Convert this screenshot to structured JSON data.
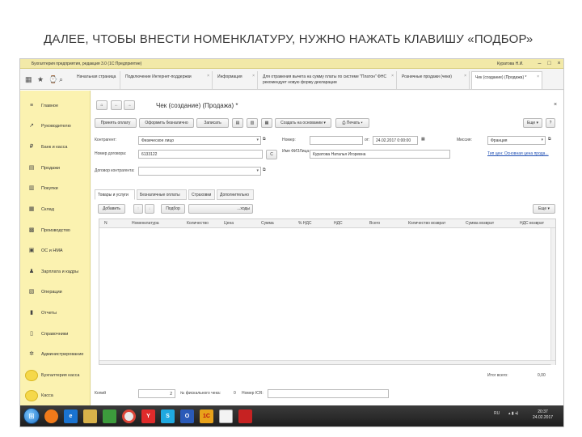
{
  "slide": {
    "title": "ДАЛЕЕ, ЧТОБЫ ВНЕСТИ НОМЕНКЛАТУРУ, НУЖНО НАЖАТЬ КЛАВИШУ «ПОДБОР»"
  },
  "window": {
    "title": "Бухгалтерия предприятия, редакция 3.0  (1С:Предприятие)",
    "user": "Куратова Н.И."
  },
  "tabs": [
    {
      "label": "Начальная страница"
    },
    {
      "label": "Подключение Интернет-поддержки"
    },
    {
      "label": "Информация"
    },
    {
      "label": "Для отражения вычета на сумму платы по системе \"Платон\" ФНС рекомендует новую форму декларации"
    },
    {
      "label": "Розничные продажи (чеки)"
    },
    {
      "label": "Чек (создание) (Продажа) *"
    }
  ],
  "sidebar": {
    "items": [
      {
        "label": "Главное",
        "icon": "menu-icon"
      },
      {
        "label": "Руководителю",
        "icon": "chart-icon"
      },
      {
        "label": "Банк и касса",
        "icon": "ruble-icon"
      },
      {
        "label": "Продажи",
        "icon": "sales-icon"
      },
      {
        "label": "Покупки",
        "icon": "cart-icon"
      },
      {
        "label": "Склад",
        "icon": "warehouse-icon"
      },
      {
        "label": "Производство",
        "icon": "factory-icon"
      },
      {
        "label": "ОС и НМА",
        "icon": "assets-icon"
      },
      {
        "label": "Зарплата и кадры",
        "icon": "people-icon"
      },
      {
        "label": "Операции",
        "icon": "operations-icon"
      },
      {
        "label": "Отчеты",
        "icon": "reports-icon"
      },
      {
        "label": "Справочники",
        "icon": "book-icon"
      },
      {
        "label": "Администрирование",
        "icon": "gear-icon"
      },
      {
        "label": "Бухгалтерия касса",
        "icon": "coins-icon"
      },
      {
        "label": "Касса",
        "icon": "coins-icon"
      }
    ]
  },
  "doc": {
    "title": "Чек (создание) (Продажа) *",
    "toolbar": {
      "accept_payment": "Принять оплату",
      "cashless": "Оформить безналично",
      "save": "Записать",
      "create_based": "Создать на основании",
      "print": "Печать",
      "more": "Еще",
      "help": "?"
    },
    "form": {
      "contractor_label": "Контрагент:",
      "contractor_value": "Физическое лицо",
      "number_label": "Номер:",
      "number_value": "",
      "from_label": "от:",
      "date_value": "24.02.2017  0:00:00",
      "mission_label": "Миссия:",
      "mission_value": "Франция",
      "contract_no_label": "Номер договора:",
      "contract_no_value": "6133122",
      "fiz_label": "Имя ФИЗЛица:",
      "fiz_value": "Куратова Наталья Игоревна",
      "price_type_link": "Тип цен: Основная цена прода...",
      "contract_label": "Договор контрагента:",
      "contract_value": ""
    },
    "subtabs": [
      {
        "label": "Товары и услуги"
      },
      {
        "label": "Безналичные оплаты"
      },
      {
        "label": "Страховки"
      },
      {
        "label": "Дополнительно"
      }
    ],
    "table_toolbar": {
      "add": "Добавить",
      "pick": "Подбор",
      "extra": "...ходы",
      "more": "Еще"
    },
    "columns": [
      "N",
      "Номенклатура",
      "Количество",
      "Цена",
      "Сумма",
      "% НДС",
      "НДС",
      "Всего",
      "Количество возврат",
      "Сумма возврат",
      "НДС возврат"
    ],
    "totals": {
      "label": "Итог всего:",
      "value": "0,00"
    },
    "footer": {
      "shift_label": "Копий",
      "shift_value": "2",
      "fiscal_label": "№ фискального чека:",
      "fiscal_value": "0",
      "icr_label": "Номер ICR:",
      "icr_value": ""
    }
  },
  "taskbar": {
    "apps": [
      "ie-icon",
      "firefox-icon",
      "explorer-icon",
      "chrome-icon",
      "yandex-icon",
      "skype-icon",
      "outlook-icon",
      "1c-icon",
      "pdf-icon"
    ],
    "app_labels": [
      "e",
      "",
      "",
      "",
      "Y",
      "S",
      "O",
      "1С",
      ""
    ],
    "lang": "RU",
    "time": "20:37",
    "date": "24.02.2017"
  },
  "colors": {
    "sidebar": "#fbf2b0",
    "titlebar": "#f2e9a8",
    "arrow": "#e3141b",
    "link": "#1f4fb3"
  }
}
